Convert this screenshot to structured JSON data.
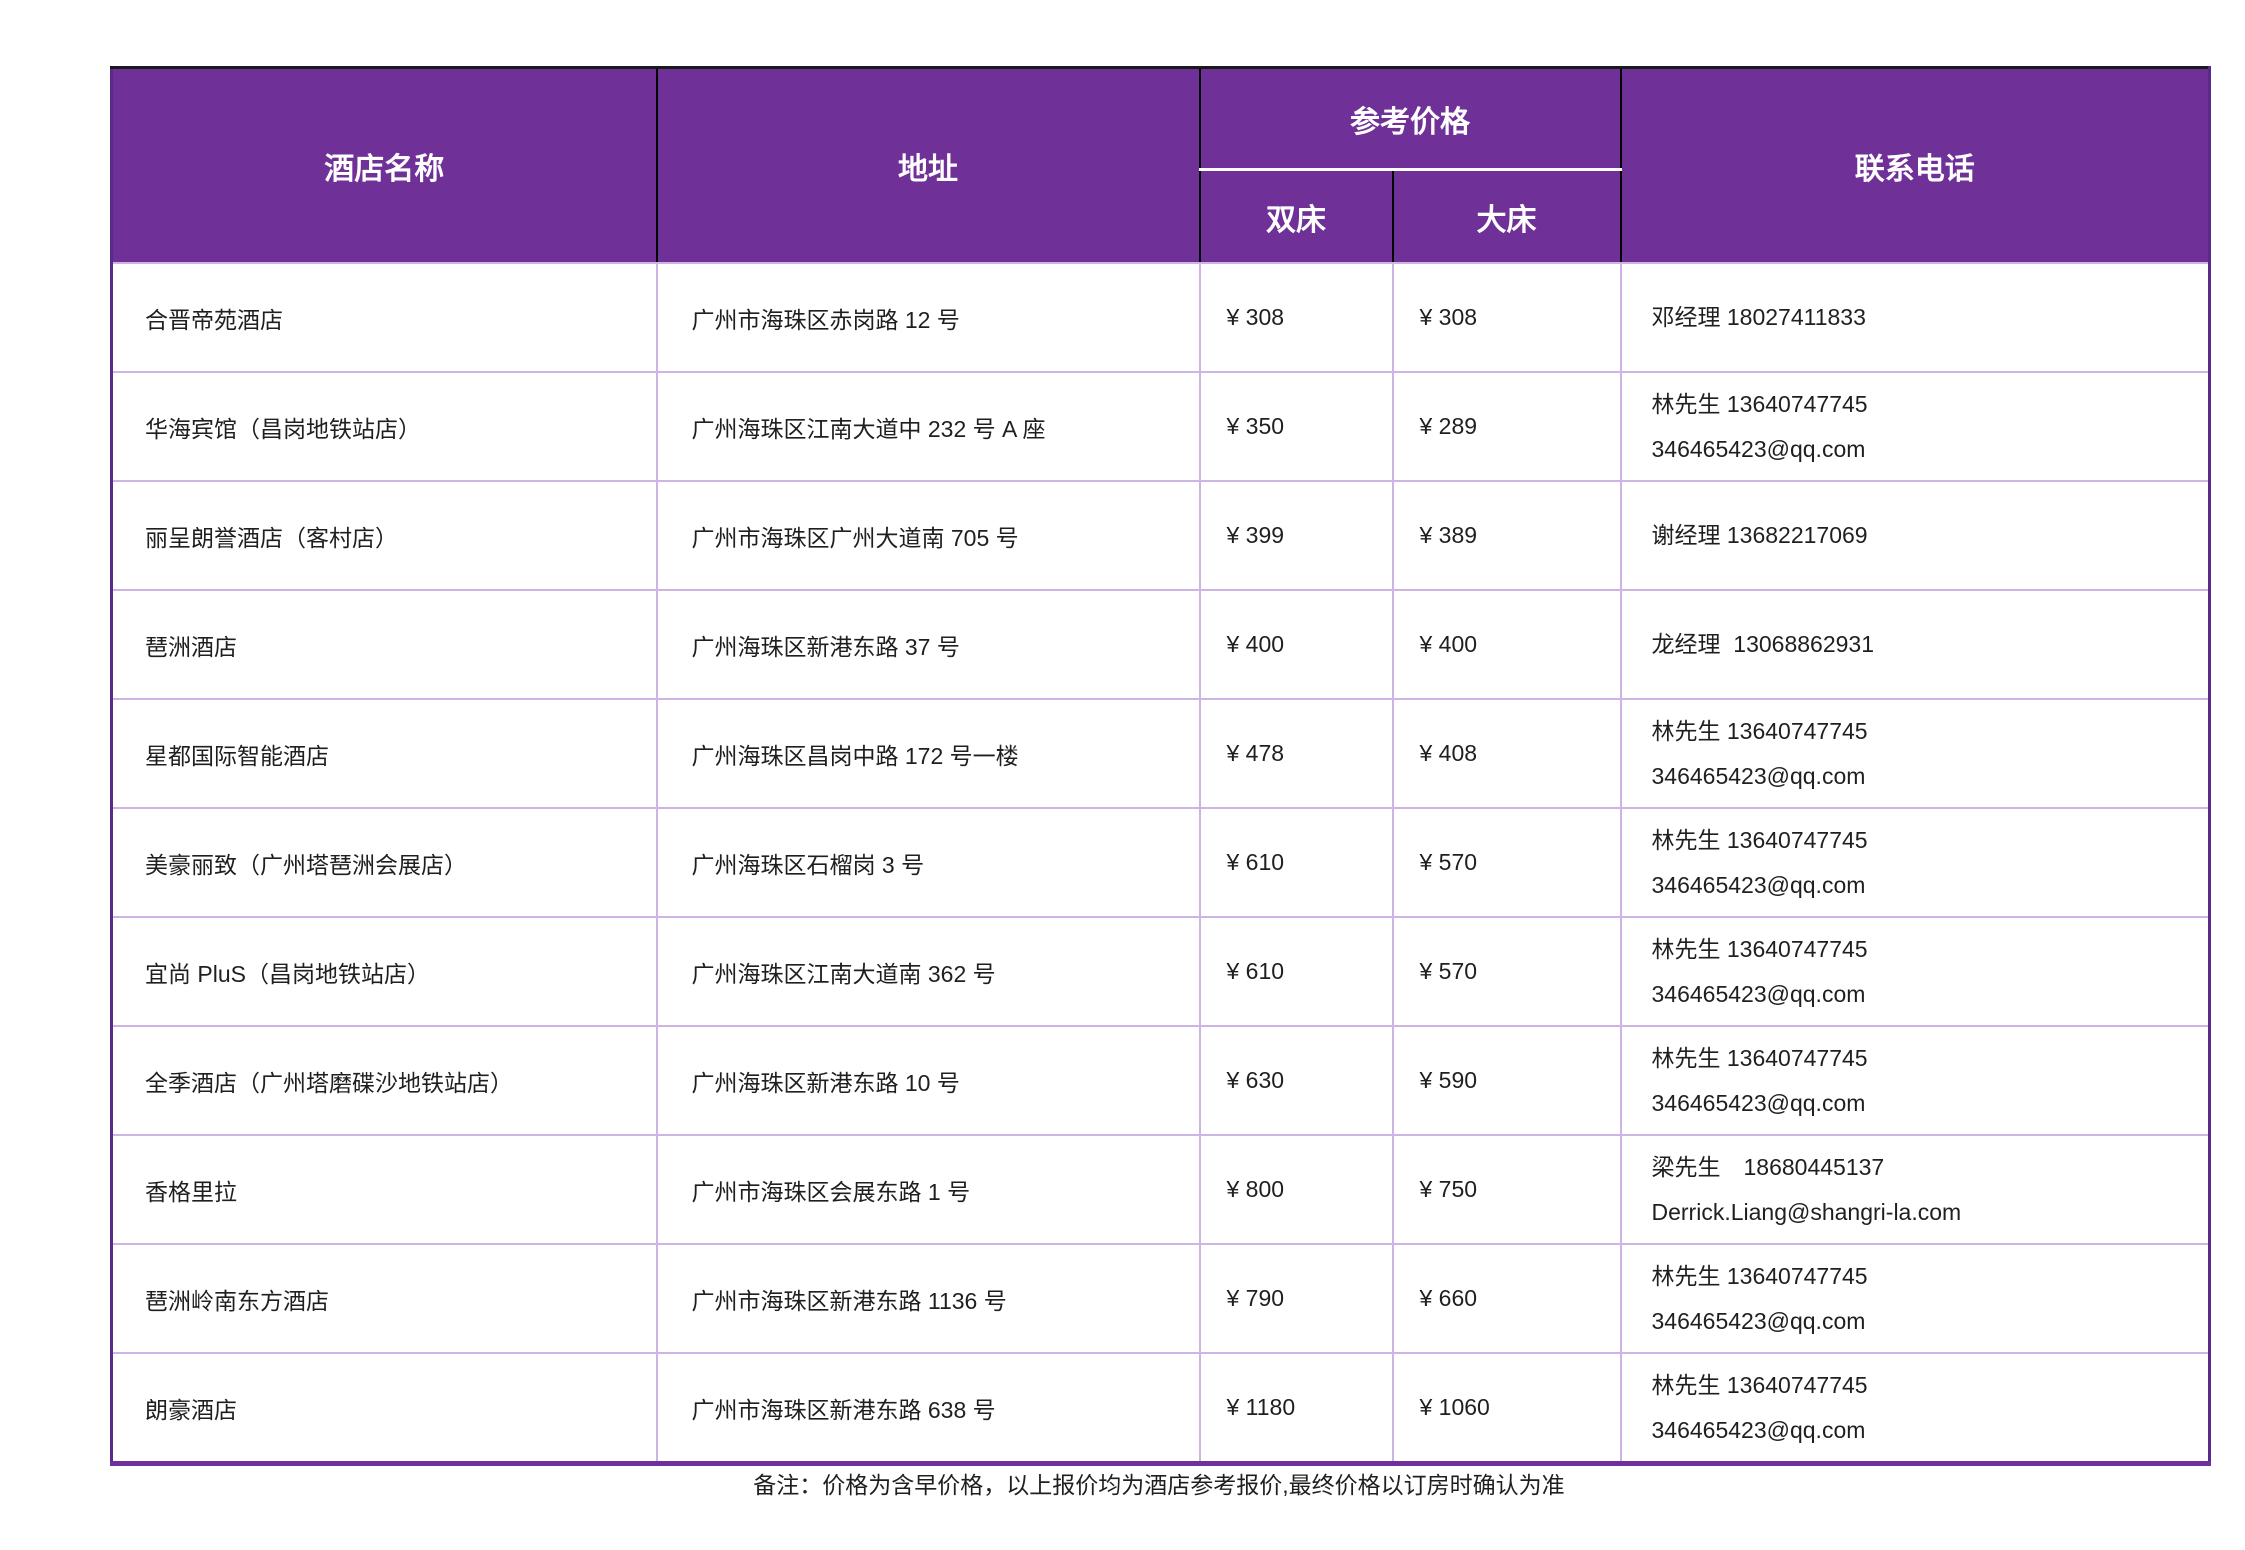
{
  "colors": {
    "page_bg": "#ffffff",
    "header_bg": "#6F3198",
    "header_text": "#ffffff",
    "grid_line": "#CDB4E4",
    "outer_border": "#5A2A88",
    "top_border": "#1A1A1A",
    "bottom_border": "#6C31A1",
    "header_divider": "#000000",
    "text": "#1F1F1F"
  },
  "table": {
    "headers": {
      "hotel": "酒店名称",
      "address": "地址",
      "price_group": "参考价格",
      "twin": "双床",
      "king": "大床",
      "phone": "联系电话"
    },
    "rows": [
      {
        "name": "合晋帝苑酒店",
        "address": "广州市海珠区赤岗路 12 号",
        "twin": "¥ 308",
        "king": "¥ 308",
        "contact": [
          "邓经理 18027411833"
        ]
      },
      {
        "name": "华海宾馆（昌岗地铁站店）",
        "address": "广州海珠区江南大道中 232 号 A 座",
        "twin": "¥ 350",
        "king": "¥ 289",
        "contact": [
          "林先生 13640747745",
          "346465423@qq.com"
        ]
      },
      {
        "name": "丽呈朗誉酒店（客村店）",
        "address": "广州市海珠区广州大道南 705 号",
        "twin": "¥ 399",
        "king": "¥ 389",
        "contact": [
          "谢经理 13682217069"
        ]
      },
      {
        "name": "琶洲酒店",
        "address": "广州海珠区新港东路 37 号",
        "twin": "¥ 400",
        "king": "¥ 400",
        "contact": [
          "龙经理  13068862931"
        ]
      },
      {
        "name": "星都国际智能酒店",
        "address": "广州海珠区昌岗中路 172 号一楼",
        "twin": "¥ 478",
        "king": "¥ 408",
        "contact": [
          "林先生 13640747745",
          "346465423@qq.com"
        ]
      },
      {
        "name": "美豪丽致（广州塔琶洲会展店）",
        "address": "广州海珠区石榴岗 3 号",
        "twin": "¥ 610",
        "king": "¥ 570",
        "contact": [
          "林先生 13640747745",
          "346465423@qq.com"
        ]
      },
      {
        "name": "宜尚 PluS（昌岗地铁站店）",
        "address": "广州海珠区江南大道南 362 号",
        "twin": "¥ 610",
        "king": "¥ 570",
        "contact": [
          "林先生 13640747745",
          "346465423@qq.com"
        ]
      },
      {
        "name": "全季酒店（广州塔磨碟沙地铁站店）",
        "address": "广州海珠区新港东路 10 号",
        "twin": "¥ 630",
        "king": "¥ 590",
        "contact": [
          "林先生 13640747745",
          "346465423@qq.com"
        ]
      },
      {
        "name": "香格里拉",
        "address": "广州市海珠区会展东路 1 号",
        "twin": "¥ 800",
        "king": "¥ 750",
        "contact": [
          "梁先生　18680445137",
          "Derrick.Liang@shangri-la.com"
        ]
      },
      {
        "name": "琶洲岭南东方酒店",
        "address": "广州市海珠区新港东路 1136 号",
        "twin": "¥ 790",
        "king": "¥ 660",
        "contact": [
          "林先生 13640747745",
          "346465423@qq.com"
        ]
      },
      {
        "name": "朗豪酒店",
        "address": "广州市海珠区新港东路 638 号",
        "twin": "¥ 1180",
        "king": "¥ 1060",
        "contact": [
          "林先生 13640747745",
          "346465423@qq.com"
        ]
      }
    ]
  },
  "footer": {
    "note": "备注：价格为含早价格，以上报价均为酒店参考报价,最终价格以订房时确认为准"
  }
}
